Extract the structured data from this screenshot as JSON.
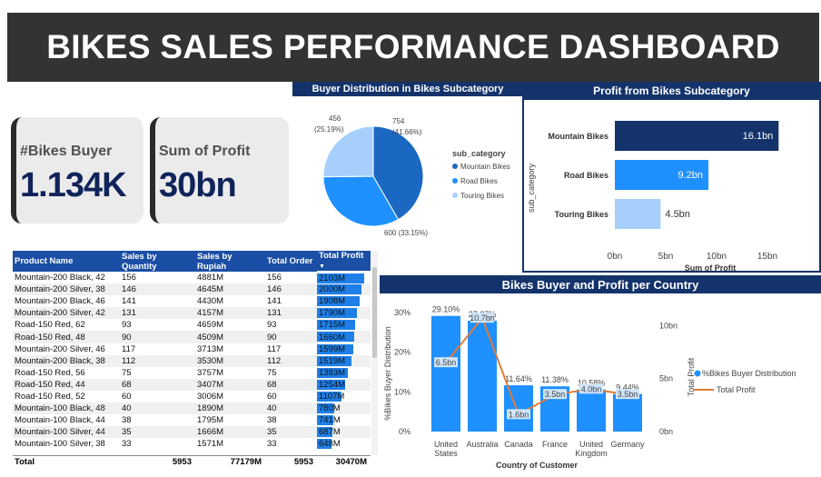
{
  "header": {
    "title": "BIKES SALES PERFORMANCE DASHBOARD"
  },
  "kpis": {
    "buyers": {
      "label": "#Bikes Buyer",
      "value": "1.134K"
    },
    "profit": {
      "label": "Sum of Profit",
      "value": "30bn"
    }
  },
  "colors": {
    "dark_navy": "#14336b",
    "mountain": "#1a68c2",
    "road": "#1e90ff",
    "touring": "#a6d0fb",
    "line": "#e07b39",
    "bar": "#1e90ff"
  },
  "pie": {
    "title": "Buyer Distribution in Bikes Subcategory",
    "legend_title": "sub_category",
    "slices": [
      {
        "name": "Mountain Bikes",
        "value": 754,
        "label": "754",
        "pct": "(41.66%)",
        "color": "#1a68c2"
      },
      {
        "name": "Road Bikes",
        "value": 600,
        "label": "600 (33.15%)",
        "pct": "",
        "color": "#1e90ff"
      },
      {
        "name": "Touring Bikes",
        "value": 456,
        "label": "456",
        "pct": "(25.19%)",
        "color": "#a6d0fb"
      }
    ]
  },
  "profit_chart": {
    "title": "Profit from Bikes Subcategory",
    "ylabel": "sub_category",
    "xlabel": "Sum of Profit",
    "ticks": [
      "0bn",
      "5bn",
      "10bn",
      "15bn"
    ],
    "xmax": 15
  },
  "table": {
    "headers": [
      "Product Name",
      "Sales by Quantity",
      "Sales by Rupiah",
      "Total Order",
      "Total Profit"
    ],
    "rows": [
      [
        "Mountain-200 Black, 42",
        "156",
        "4881M",
        "156",
        "2103M"
      ],
      [
        "Mountain-200 Silver, 38",
        "146",
        "4645M",
        "146",
        "2000M"
      ],
      [
        "Mountain-200 Black, 46",
        "141",
        "4430M",
        "141",
        "1908M"
      ],
      [
        "Mountain-200 Silver, 42",
        "131",
        "4157M",
        "131",
        "1790M"
      ],
      [
        "Road-150 Red, 62",
        "93",
        "4659M",
        "93",
        "1715M"
      ],
      [
        "Road-150 Red, 48",
        "90",
        "4509M",
        "90",
        "1660M"
      ],
      [
        "Mountain-200 Silver, 46",
        "117",
        "3713M",
        "117",
        "1599M"
      ],
      [
        "Mountain-200 Black, 38",
        "112",
        "3530M",
        "112",
        "1519M"
      ],
      [
        "Road-150 Red, 56",
        "75",
        "3757M",
        "75",
        "1383M"
      ],
      [
        "Road-150 Red, 44",
        "68",
        "3407M",
        "68",
        "1254M"
      ],
      [
        "Road-150 Red, 52",
        "60",
        "3006M",
        "60",
        "1107M"
      ],
      [
        "Mountain-100 Black, 48",
        "40",
        "1890M",
        "40",
        "780M"
      ],
      [
        "Mountain-100 Black, 44",
        "38",
        "1795M",
        "38",
        "741M"
      ],
      [
        "Mountain-100 Silver, 44",
        "35",
        "1666M",
        "35",
        "687M"
      ],
      [
        "Mountain-100 Silver, 38",
        "33",
        "1571M",
        "33",
        "648M"
      ]
    ],
    "profit_values": [
      2103,
      2000,
      1908,
      1790,
      1715,
      1660,
      1599,
      1519,
      1383,
      1254,
      1107,
      780,
      741,
      687,
      648
    ],
    "profit_max": 2103,
    "total": {
      "label": "Total",
      "qty": "5953",
      "rupiah": "77179M",
      "orders": "5953",
      "profit": "30470M"
    }
  },
  "country_chart": {
    "title": "Bikes Buyer and Profit per Country",
    "ylabel_left": "%Bikes Buyer Distribution",
    "ylabel_right": "Total Profit",
    "xlabel": "Country of Customer",
    "left_ticks": [
      "0%",
      "10%",
      "20%",
      "30%"
    ],
    "right_ticks": [
      "0bn",
      "5bn",
      "10bn"
    ],
    "legend": [
      "%Bikes Buyer Distribution",
      "Total Profit"
    ]
  },
  "chart_data": [
    {
      "type": "pie",
      "title": "Buyer Distribution in Bikes Subcategory",
      "categories": [
        "Mountain Bikes",
        "Road Bikes",
        "Touring Bikes"
      ],
      "values": [
        754,
        600,
        456
      ],
      "percents": [
        41.66,
        33.15,
        25.19
      ],
      "legend_title": "sub_category"
    },
    {
      "type": "bar",
      "orientation": "horizontal",
      "title": "Profit from Bikes Subcategory",
      "categories": [
        "Mountain Bikes",
        "Road Bikes",
        "Touring Bikes"
      ],
      "values": [
        16.1,
        9.2,
        4.5
      ],
      "labels": [
        "16.1bn",
        "9.2bn",
        "4.5bn"
      ],
      "xlabel": "Sum of Profit",
      "ylabel": "sub_category",
      "xlim": [
        0,
        15
      ]
    },
    {
      "type": "bar",
      "title": "Bikes Buyer and Profit per Country",
      "categories": [
        "United States",
        "Australia",
        "Canada",
        "France",
        "United Kingdom",
        "Germany"
      ],
      "category_lines": [
        [
          "United",
          "States"
        ],
        [
          "Australia"
        ],
        [
          "Canada"
        ],
        [
          "France"
        ],
        [
          "United",
          "Kingdom"
        ],
        [
          "Germany"
        ]
      ],
      "series": [
        {
          "name": "%Bikes Buyer Distribution",
          "values": [
            29.1,
            27.87,
            11.64,
            11.38,
            10.58,
            9.44
          ],
          "labels": [
            "29.10%",
            "27.87%",
            "11.64%",
            "11.38%",
            "10.58%",
            "9.44%"
          ]
        },
        {
          "name": "Total Profit",
          "values": [
            6.5,
            10.7,
            1.6,
            3.5,
            4.0,
            3.5
          ],
          "labels": [
            "6.5bn",
            "10.7bn",
            "1.6bn",
            "3.5bn",
            "4.0bn",
            "3.5bn"
          ]
        }
      ],
      "xlabel": "Country of Customer",
      "ylim": [
        0,
        32
      ],
      "y2lim": [
        0,
        12
      ]
    }
  ]
}
